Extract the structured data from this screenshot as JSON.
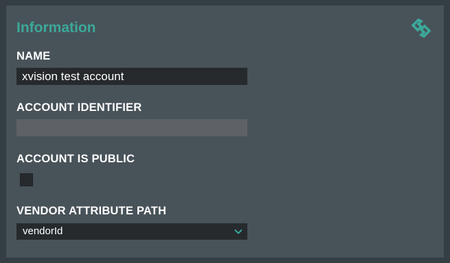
{
  "panel": {
    "title": "Information"
  },
  "fields": {
    "name_label": "NAME",
    "name_value": "xvision test account",
    "identifier_label": "ACCOUNT IDENTIFIER",
    "identifier_value": "",
    "public_label": "ACCOUNT IS PUBLIC",
    "public_checked": false,
    "vendor_label": "VENDOR ATTRIBUTE PATH",
    "vendor_value": "vendorId"
  },
  "icons": {
    "logo": "teal-logo-icon",
    "dropdown": "chevron-down-icon"
  },
  "colors": {
    "accent": "#3ba99a",
    "panel_bg": "#485259",
    "page_bg": "#363e45",
    "input_bg": "#262a2d",
    "disabled_input_bg": "#5e6266"
  }
}
